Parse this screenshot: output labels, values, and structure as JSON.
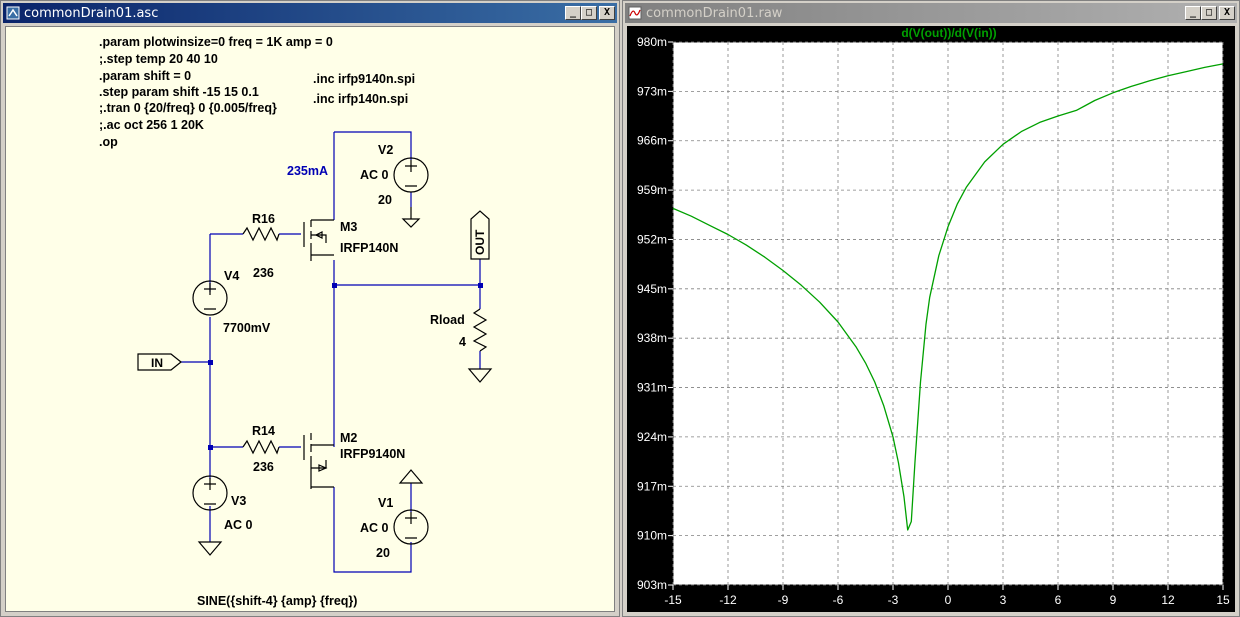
{
  "schematic_window": {
    "title": "commonDrain01.asc",
    "buttons": [
      "_",
      "□",
      "X"
    ],
    "directives": [
      ".param plotwinsize=0 freq = 1K amp = 0",
      ";.step temp 20 40 10",
      ".param shift = 0",
      ".step param shift -15 15 0.1",
      ";.tran 0 {20/freq} 0 {0.005/freq}",
      ";.ac oct 256 1 20K",
      ".op"
    ],
    "includes": [
      ".inc irfp9140n.spi",
      ".inc irfp140n.spi"
    ],
    "current_label": "235mA",
    "components": {
      "v2_name": "V2",
      "v2_ac": "AC 0",
      "v2_val": "20",
      "m3_name": "M3",
      "m3_model": "IRFP140N",
      "r16_name": "R16",
      "r16_val": "236",
      "v4_name": "V4",
      "v4_val": "7700mV",
      "out_flag": "OUT",
      "rload_name": "Rload",
      "rload_val": "4",
      "in_flag": "IN",
      "r14_name": "R14",
      "r14_val": "236",
      "m2_name": "M2",
      "m2_model": "IRFP9140N",
      "v3_name": "V3",
      "v3_ac": "AC 0",
      "v1_name": "V1",
      "v1_ac": "AC 0",
      "v1_val": "20"
    },
    "source_expr": "SINE({shift-4} {amp} {freq})"
  },
  "plot_window": {
    "title": "commonDrain01.raw",
    "buttons": [
      "_",
      "□",
      "X"
    ]
  },
  "colors": {
    "wire": "#0000b4",
    "component": "#000000",
    "trace": "#00a000",
    "grid": "#808080",
    "schematic_bg": "#ffffe8",
    "plot_bg": "#ffffff",
    "title_active": "#0a246a"
  },
  "chart_data": {
    "type": "line",
    "title": "d(V(out))/d(V(in))",
    "xlabel": "",
    "ylabel": "",
    "xlim": [
      -15,
      15
    ],
    "ylim": [
      0.903,
      0.98
    ],
    "x_ticks": [
      -15,
      -12,
      -9,
      -6,
      -3,
      0,
      3,
      6,
      9,
      12,
      15
    ],
    "y_ticks": [
      0.903,
      0.91,
      0.917,
      0.924,
      0.931,
      0.938,
      0.945,
      0.952,
      0.959,
      0.966,
      0.973,
      0.98
    ],
    "y_tick_labels": [
      "903m",
      "910m",
      "917m",
      "924m",
      "931m",
      "938m",
      "945m",
      "952m",
      "959m",
      "966m",
      "973m",
      "980m"
    ],
    "x_tick_labels": [
      "-15",
      "-12",
      "-9",
      "-6",
      "-3",
      "0",
      "3",
      "6",
      "9",
      "12",
      "15"
    ],
    "grid": true,
    "series": [
      {
        "name": "d(V(out))/d(V(in))",
        "x": [
          -15,
          -14,
          -13,
          -12,
          -11,
          -10,
          -9,
          -8,
          -7,
          -6,
          -5,
          -4.5,
          -4,
          -3.5,
          -3,
          -2.7,
          -2.4,
          -2.2,
          -2.0,
          -1.8,
          -1.5,
          -1.2,
          -1,
          -0.5,
          0,
          0.5,
          1,
          2,
          3,
          4,
          5,
          6,
          7,
          7.5,
          8,
          9,
          10,
          11,
          12,
          13,
          14,
          15
        ],
        "y": [
          0.9564,
          0.9553,
          0.954,
          0.9527,
          0.9512,
          0.9495,
          0.9476,
          0.9455,
          0.9431,
          0.9403,
          0.9367,
          0.9345,
          0.9318,
          0.9284,
          0.924,
          0.9203,
          0.9155,
          0.9108,
          0.912,
          0.9205,
          0.9318,
          0.94,
          0.9438,
          0.9497,
          0.9538,
          0.957,
          0.9594,
          0.963,
          0.9655,
          0.9673,
          0.9686,
          0.9695,
          0.9703,
          0.971,
          0.9717,
          0.9728,
          0.9737,
          0.9745,
          0.9752,
          0.9758,
          0.9764,
          0.9769
        ]
      }
    ]
  }
}
